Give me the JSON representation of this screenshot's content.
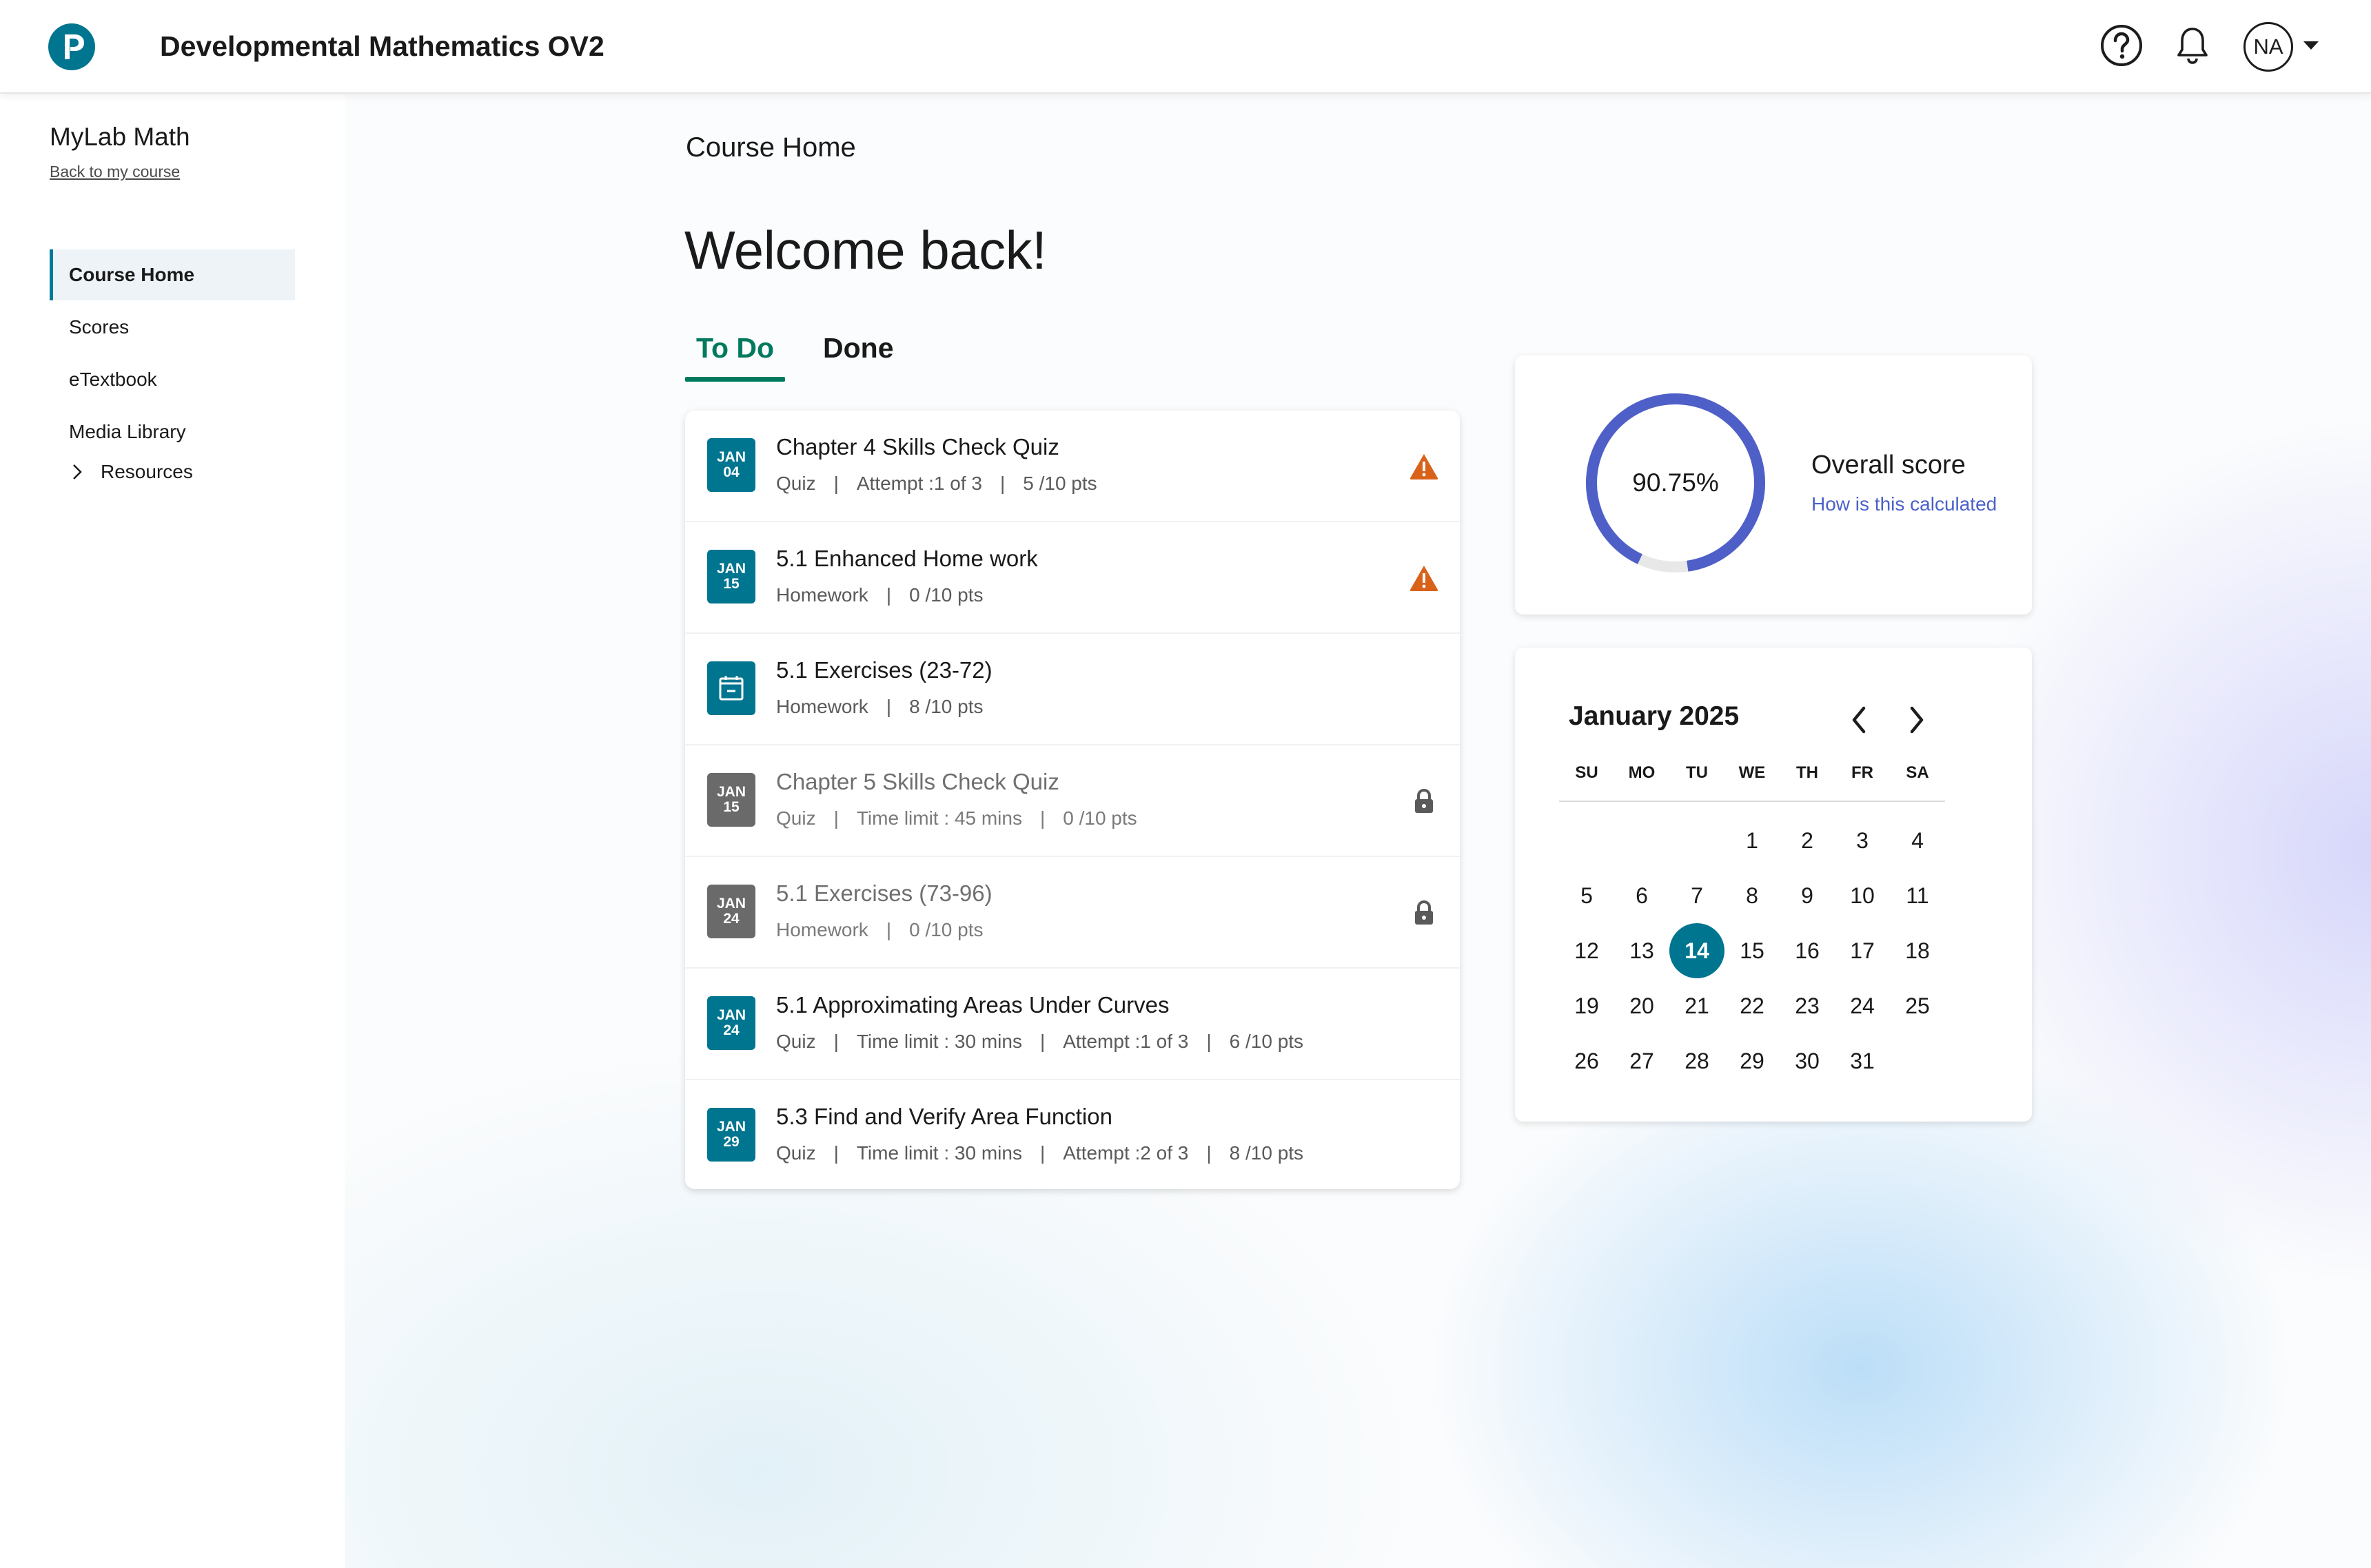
{
  "header": {
    "title": "Developmental Mathematics OV2",
    "avatar_initials": "NA",
    "brand_color": "#00758f"
  },
  "sidebar": {
    "product": "MyLab Math",
    "back_link": "Back to my course",
    "items": [
      {
        "label": "Course Home",
        "active": true
      },
      {
        "label": "Scores",
        "active": false
      },
      {
        "label": "eTextbook",
        "active": false
      },
      {
        "label": "Media Library",
        "active": false
      }
    ],
    "sub_item": "Resources"
  },
  "main": {
    "page_title": "Course Home",
    "welcome": "Welcome back!",
    "tabs": [
      {
        "label": "To Do",
        "active": true
      },
      {
        "label": "Done",
        "active": false
      }
    ],
    "tasks": [
      {
        "month": "JAN",
        "day": "04",
        "title": "Chapter 4 Skills Check Quiz",
        "meta": [
          "Quiz",
          "Attempt :1 of 3",
          "5 /10 pts"
        ],
        "status": "warning-icon",
        "locked": false
      },
      {
        "month": "JAN",
        "day": "15",
        "title": "5.1 Enhanced Home work",
        "meta": [
          "Homework",
          "0 /10 pts"
        ],
        "status": "warning-icon",
        "locked": false
      },
      {
        "month": "",
        "day": "",
        "title": "5.1 Exercises (23-72)",
        "meta": [
          "Homework",
          "8 /10 pts"
        ],
        "status": "",
        "icon": "calendar-icon",
        "locked": false
      },
      {
        "month": "JAN",
        "day": "15",
        "title": "Chapter 5 Skills Check Quiz",
        "meta": [
          "Quiz",
          "Time limit : 45 mins",
          "0 /10 pts"
        ],
        "status": "lock-icon",
        "locked": true
      },
      {
        "month": "JAN",
        "day": "24",
        "title": "5.1 Exercises (73-96)",
        "meta": [
          "Homework",
          "0 /10 pts"
        ],
        "status": "lock-icon",
        "locked": true
      },
      {
        "month": "JAN",
        "day": "24",
        "title": "5.1 Approximating Areas Under Curves",
        "meta": [
          "Quiz",
          "Time limit : 30 mins",
          "Attempt :1 of 3",
          "6 /10 pts"
        ],
        "status": "",
        "locked": false
      },
      {
        "month": "JAN",
        "day": "29",
        "title": "5.3 Find and Verify Area Function",
        "meta": [
          "Quiz",
          "Time limit : 30 mins",
          "Attempt :2 of 3",
          "8 /10 pts"
        ],
        "status": "",
        "locked": false
      }
    ]
  },
  "score": {
    "value_text": "90.75%",
    "fraction": 0.9075,
    "label": "Overall score",
    "link": "How is this calculated",
    "ring_color": "#4f5fc8"
  },
  "calendar": {
    "title": "January 2025",
    "weekdays": [
      "SU",
      "MO",
      "TU",
      "WE",
      "TH",
      "FR",
      "SA"
    ],
    "weeks": [
      [
        "",
        "",
        "",
        "1",
        "2",
        "3",
        "4"
      ],
      [
        "5",
        "6",
        "7",
        "8",
        "9",
        "10",
        "11"
      ],
      [
        "12",
        "13",
        "14",
        "15",
        "16",
        "17",
        "18"
      ],
      [
        "19",
        "20",
        "21",
        "22",
        "23",
        "24",
        "25"
      ],
      [
        "26",
        "27",
        "28",
        "29",
        "30",
        "31",
        ""
      ]
    ],
    "today": "14"
  }
}
